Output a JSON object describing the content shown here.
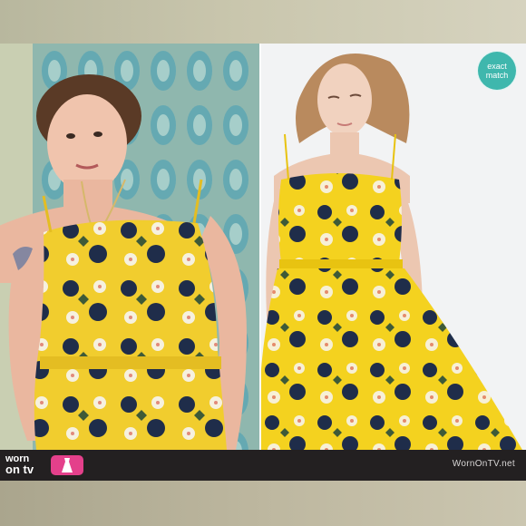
{
  "badge": {
    "line1": "exact",
    "line2": "match"
  },
  "footer": {
    "logo_line1": "worn",
    "logo_line2": "on tv",
    "watermark": "WornOnTV.net"
  },
  "icons": {
    "logo_icon": "dress-icon",
    "badge": "exact-match-badge"
  },
  "colors": {
    "dress_yellow": "#f1cd2e",
    "flower_navy": "#1f2d4a",
    "badge_teal": "#3fb7ad",
    "footer_bg": "#232021",
    "logo_pink": "#e4408b"
  }
}
